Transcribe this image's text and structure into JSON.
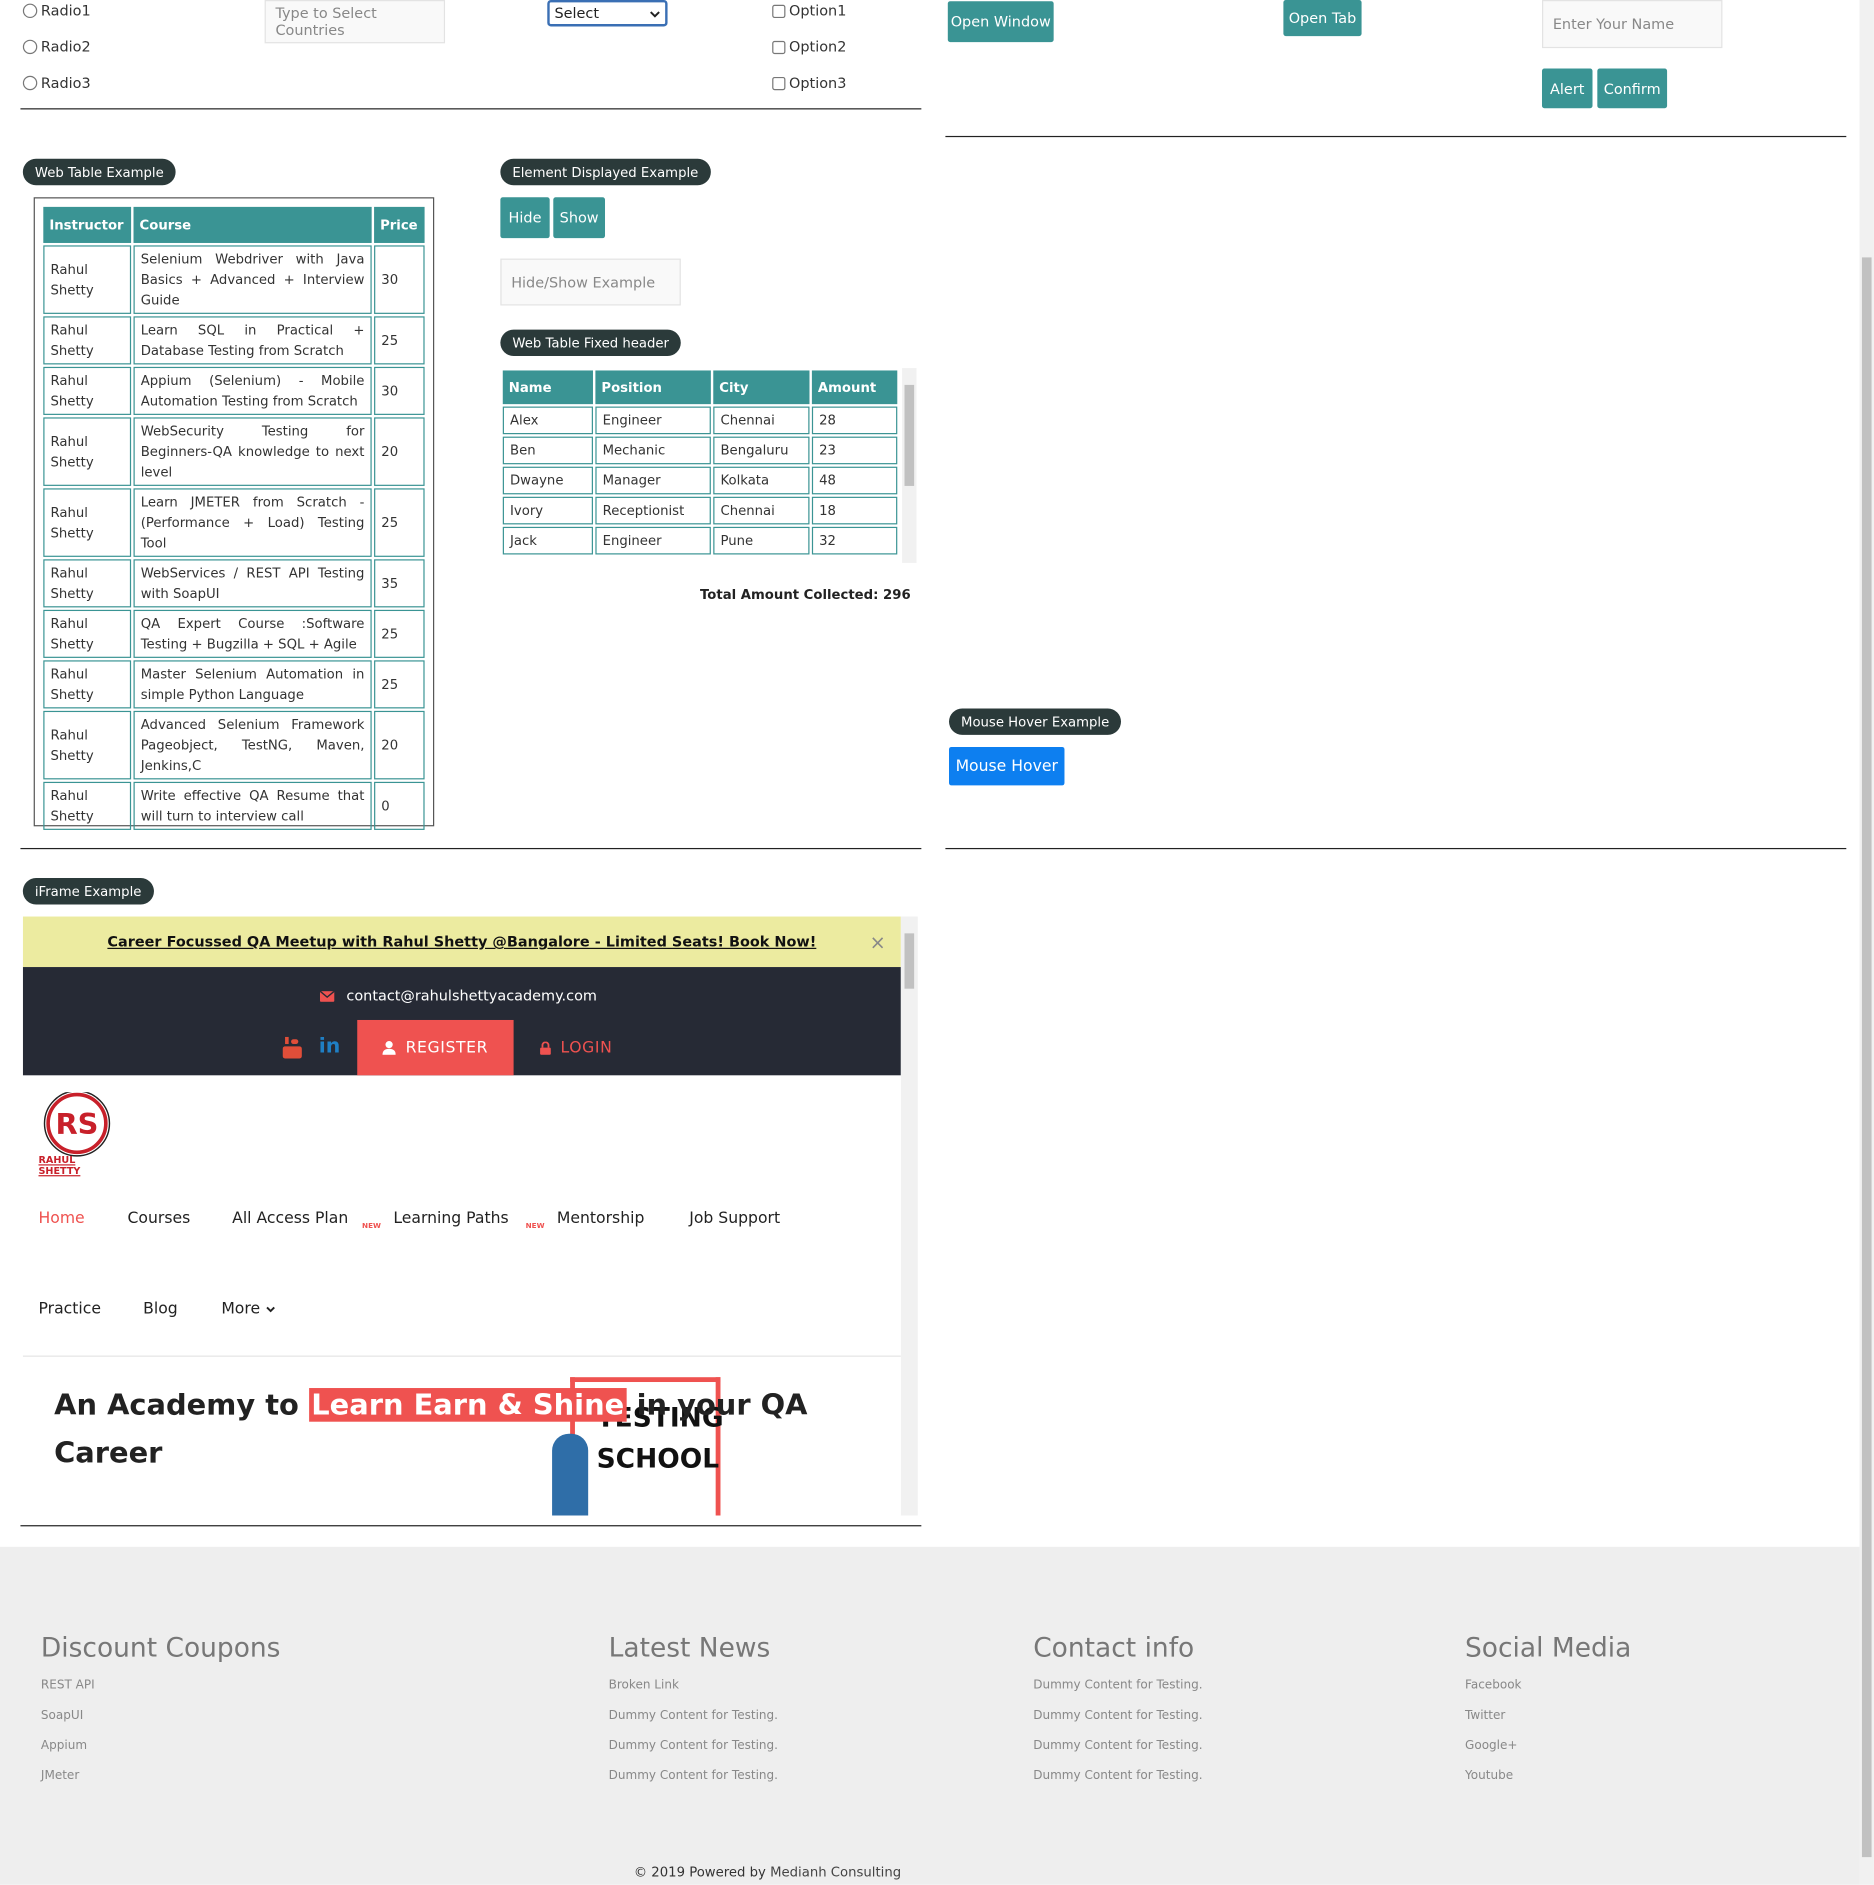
{
  "radios": [
    "Radio1",
    "Radio2",
    "Radio3"
  ],
  "autocomplete": {
    "placeholder": "Type to Select Countries"
  },
  "dropdown": {
    "selected": "Select"
  },
  "checkboxes": [
    "Option1",
    "Option2",
    "Option3"
  ],
  "window": {
    "open_window": "Open Window",
    "open_tab": "Open Tab"
  },
  "alert": {
    "name_placeholder": "Enter Your Name",
    "alert_label": "Alert",
    "confirm_label": "Confirm"
  },
  "web_table": {
    "legend": "Web Table Example",
    "headers": [
      "Instructor",
      "Course",
      "Price"
    ],
    "rows": [
      {
        "instructor": "Rahul Shetty",
        "course": "Selenium Webdriver with Java Basics + Advanced + Interview Guide",
        "price": "30"
      },
      {
        "instructor": "Rahul Shetty",
        "course": "Learn SQL in Practical + Database Testing from Scratch",
        "price": "25"
      },
      {
        "instructor": "Rahul Shetty",
        "course": "Appium (Selenium) - Mobile Automation Testing from Scratch",
        "price": "30"
      },
      {
        "instructor": "Rahul Shetty",
        "course": "WebSecurity Testing for Beginners-QA knowledge to next level",
        "price": "20"
      },
      {
        "instructor": "Rahul Shetty",
        "course": "Learn JMETER from Scratch - (Performance + Load) Testing Tool",
        "price": "25"
      },
      {
        "instructor": "Rahul Shetty",
        "course": "WebServices / REST API Testing with SoapUI",
        "price": "35"
      },
      {
        "instructor": "Rahul Shetty",
        "course": "QA Expert Course :Software Testing + Bugzilla + SQL + Agile",
        "price": "25"
      },
      {
        "instructor": "Rahul Shetty",
        "course": "Master Selenium Automation in simple Python Language",
        "price": "25"
      },
      {
        "instructor": "Rahul Shetty",
        "course": "Advanced Selenium Framework Pageobject, TestNG, Maven, Jenkins,C",
        "price": "20"
      },
      {
        "instructor": "Rahul Shetty",
        "course": "Write effective QA Resume that will turn to interview call",
        "price": "0"
      }
    ]
  },
  "displayed": {
    "legend": "Element Displayed Example",
    "hide": "Hide",
    "show": "Show",
    "placeholder": "Hide/Show Example"
  },
  "fixed_table": {
    "legend": "Web Table Fixed header",
    "headers": [
      "Name",
      "Position",
      "City",
      "Amount"
    ],
    "rows": [
      [
        "Alex",
        "Engineer",
        "Chennai",
        "28"
      ],
      [
        "Ben",
        "Mechanic",
        "Bengaluru",
        "23"
      ],
      [
        "Dwayne",
        "Manager",
        "Kolkata",
        "48"
      ],
      [
        "Ivory",
        "Receptionist",
        "Chennai",
        "18"
      ],
      [
        "Jack",
        "Engineer",
        "Pune",
        "32"
      ]
    ],
    "total_label": "Total Amount Collected:",
    "total_value": "296"
  },
  "mouse_hover": {
    "legend": "Mouse Hover Example",
    "button": "Mouse Hover"
  },
  "iframe": {
    "legend": "iFrame Example",
    "banner": "Career Focussed QA Meetup with Rahul Shetty @Bangalore - Limited Seats! Book Now!",
    "close": "×",
    "email": "contact@rahulshettyacademy.com",
    "register": "REGISTER",
    "login": "LOGIN",
    "logo_text": "RAHUL SHETTY",
    "nav": [
      "Home",
      "Courses",
      "All Access Plan",
      "Learning Paths",
      "Mentorship",
      "Job Support",
      "Practice",
      "Blog",
      "More"
    ],
    "new_badge": "NEW",
    "headline_a": "An Academy to",
    "headline_b": "Learn Earn & Shine",
    "headline_c": "in your QA",
    "headline_d": "Career",
    "poster_a": "TESTING",
    "poster_b": "SCHOOL"
  },
  "footer": {
    "columns": [
      {
        "title": "Discount Coupons",
        "links": [
          "REST API",
          "SoapUI",
          "Appium",
          "JMeter"
        ]
      },
      {
        "title": "Latest News",
        "links": [
          "Broken Link",
          "Dummy Content for Testing.",
          "Dummy Content for Testing.",
          "Dummy Content for Testing."
        ]
      },
      {
        "title": "Contact info",
        "links": [
          "Dummy Content for Testing.",
          "Dummy Content for Testing.",
          "Dummy Content for Testing.",
          "Dummy Content for Testing."
        ]
      },
      {
        "title": "Social Media",
        "links": [
          "Facebook",
          "Twitter",
          "Google+",
          "Youtube"
        ]
      }
    ],
    "copyright": "© 2019 Powered by",
    "company": "Medianh Consulting"
  },
  "colors": {
    "teal": "#3a9494",
    "blue": "#0d7ff0",
    "legend": "#2b3a3a",
    "banner": "#eceba0",
    "dark": "#262a35",
    "red": "#ef5250"
  }
}
